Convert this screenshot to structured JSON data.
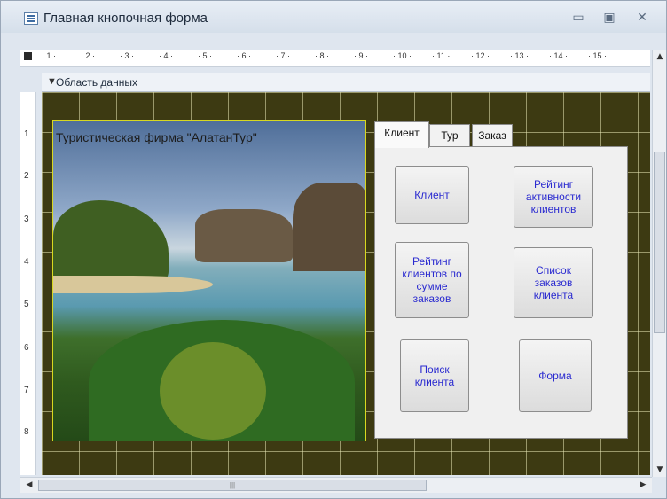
{
  "window": {
    "title": "Главная кнопочная форма",
    "minimize_icon": "minimize-icon",
    "maximize_icon": "maximize-icon",
    "close_icon": "close-icon"
  },
  "ruler": {
    "h_ticks": [
      "· 1 ·",
      "· 2 ·",
      "· 3 ·",
      "· 4 ·",
      "· 5 ·",
      "· 6 ·",
      "· 7 ·",
      "· 8 ·",
      "· 9 ·",
      "· 10 ·",
      "· 11 ·",
      "· 12 ·",
      "· 13 ·",
      "· 14 ·",
      "· 15 ·"
    ],
    "v_ticks": [
      "1",
      "2",
      "3",
      "4",
      "5",
      "6",
      "7",
      "8"
    ]
  },
  "section": {
    "label": "Область данных"
  },
  "form": {
    "image_caption": "Туристическая фирма \"АлатанТур\"",
    "tabs": [
      {
        "label": "Клиент",
        "active": true
      },
      {
        "label": "Тур",
        "active": false
      },
      {
        "label": "Заказ",
        "active": false
      }
    ],
    "buttons": {
      "client": "Клиент",
      "activity_rating": "Рейтинг активности клиентов",
      "orders_sum_rating": "Рейтинг клиентов по сумме заказов",
      "client_orders_list": "Список заказов клиента",
      "find_client": "Поиск клиента",
      "form": "Форма"
    }
  },
  "colors": {
    "grid_background": "#3d3a12",
    "button_text": "#2a2ad0",
    "window_chrome": "#dfe6ef"
  }
}
